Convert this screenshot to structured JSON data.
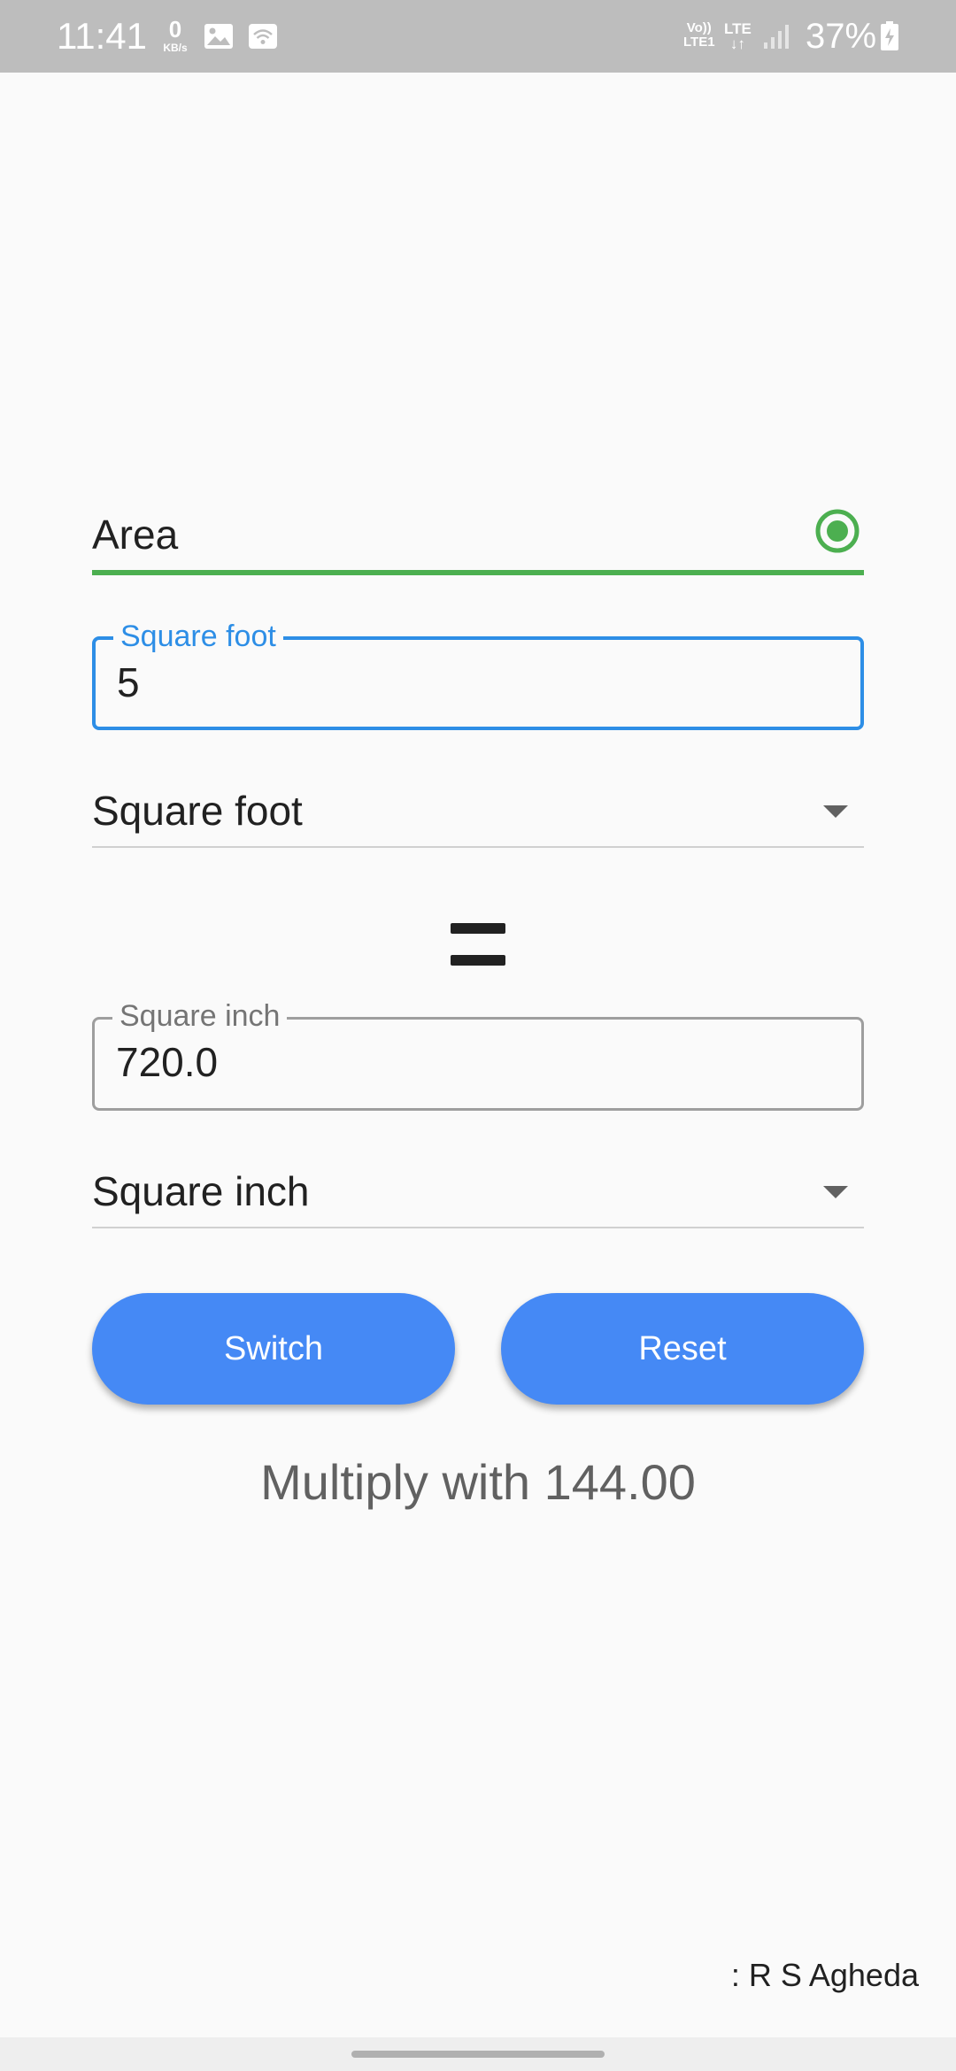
{
  "status_bar": {
    "time": "11:41",
    "net_speed_value": "0",
    "net_speed_unit": "KB/s",
    "volte_top": "Vo))",
    "volte_bottom": "LTE1",
    "lte_label": "LTE",
    "battery_percent": "37%",
    "icons": [
      "gallery-icon",
      "wifi-icon",
      "signal-icon",
      "battery-charging-icon"
    ]
  },
  "converter": {
    "type_label": "Area",
    "type_selected": true,
    "accent_color": "#4caf50",
    "input": {
      "label": "Square foot",
      "value": "5"
    },
    "from_unit": "Square foot",
    "output": {
      "label": "Square inch",
      "value": "720.0"
    },
    "to_unit": "Square inch",
    "switch_label": "Switch",
    "reset_label": "Reset",
    "button_color": "#4589f5",
    "formula": "Multiply with 144.00"
  },
  "footer": {
    "credit": ": R S Agheda"
  }
}
